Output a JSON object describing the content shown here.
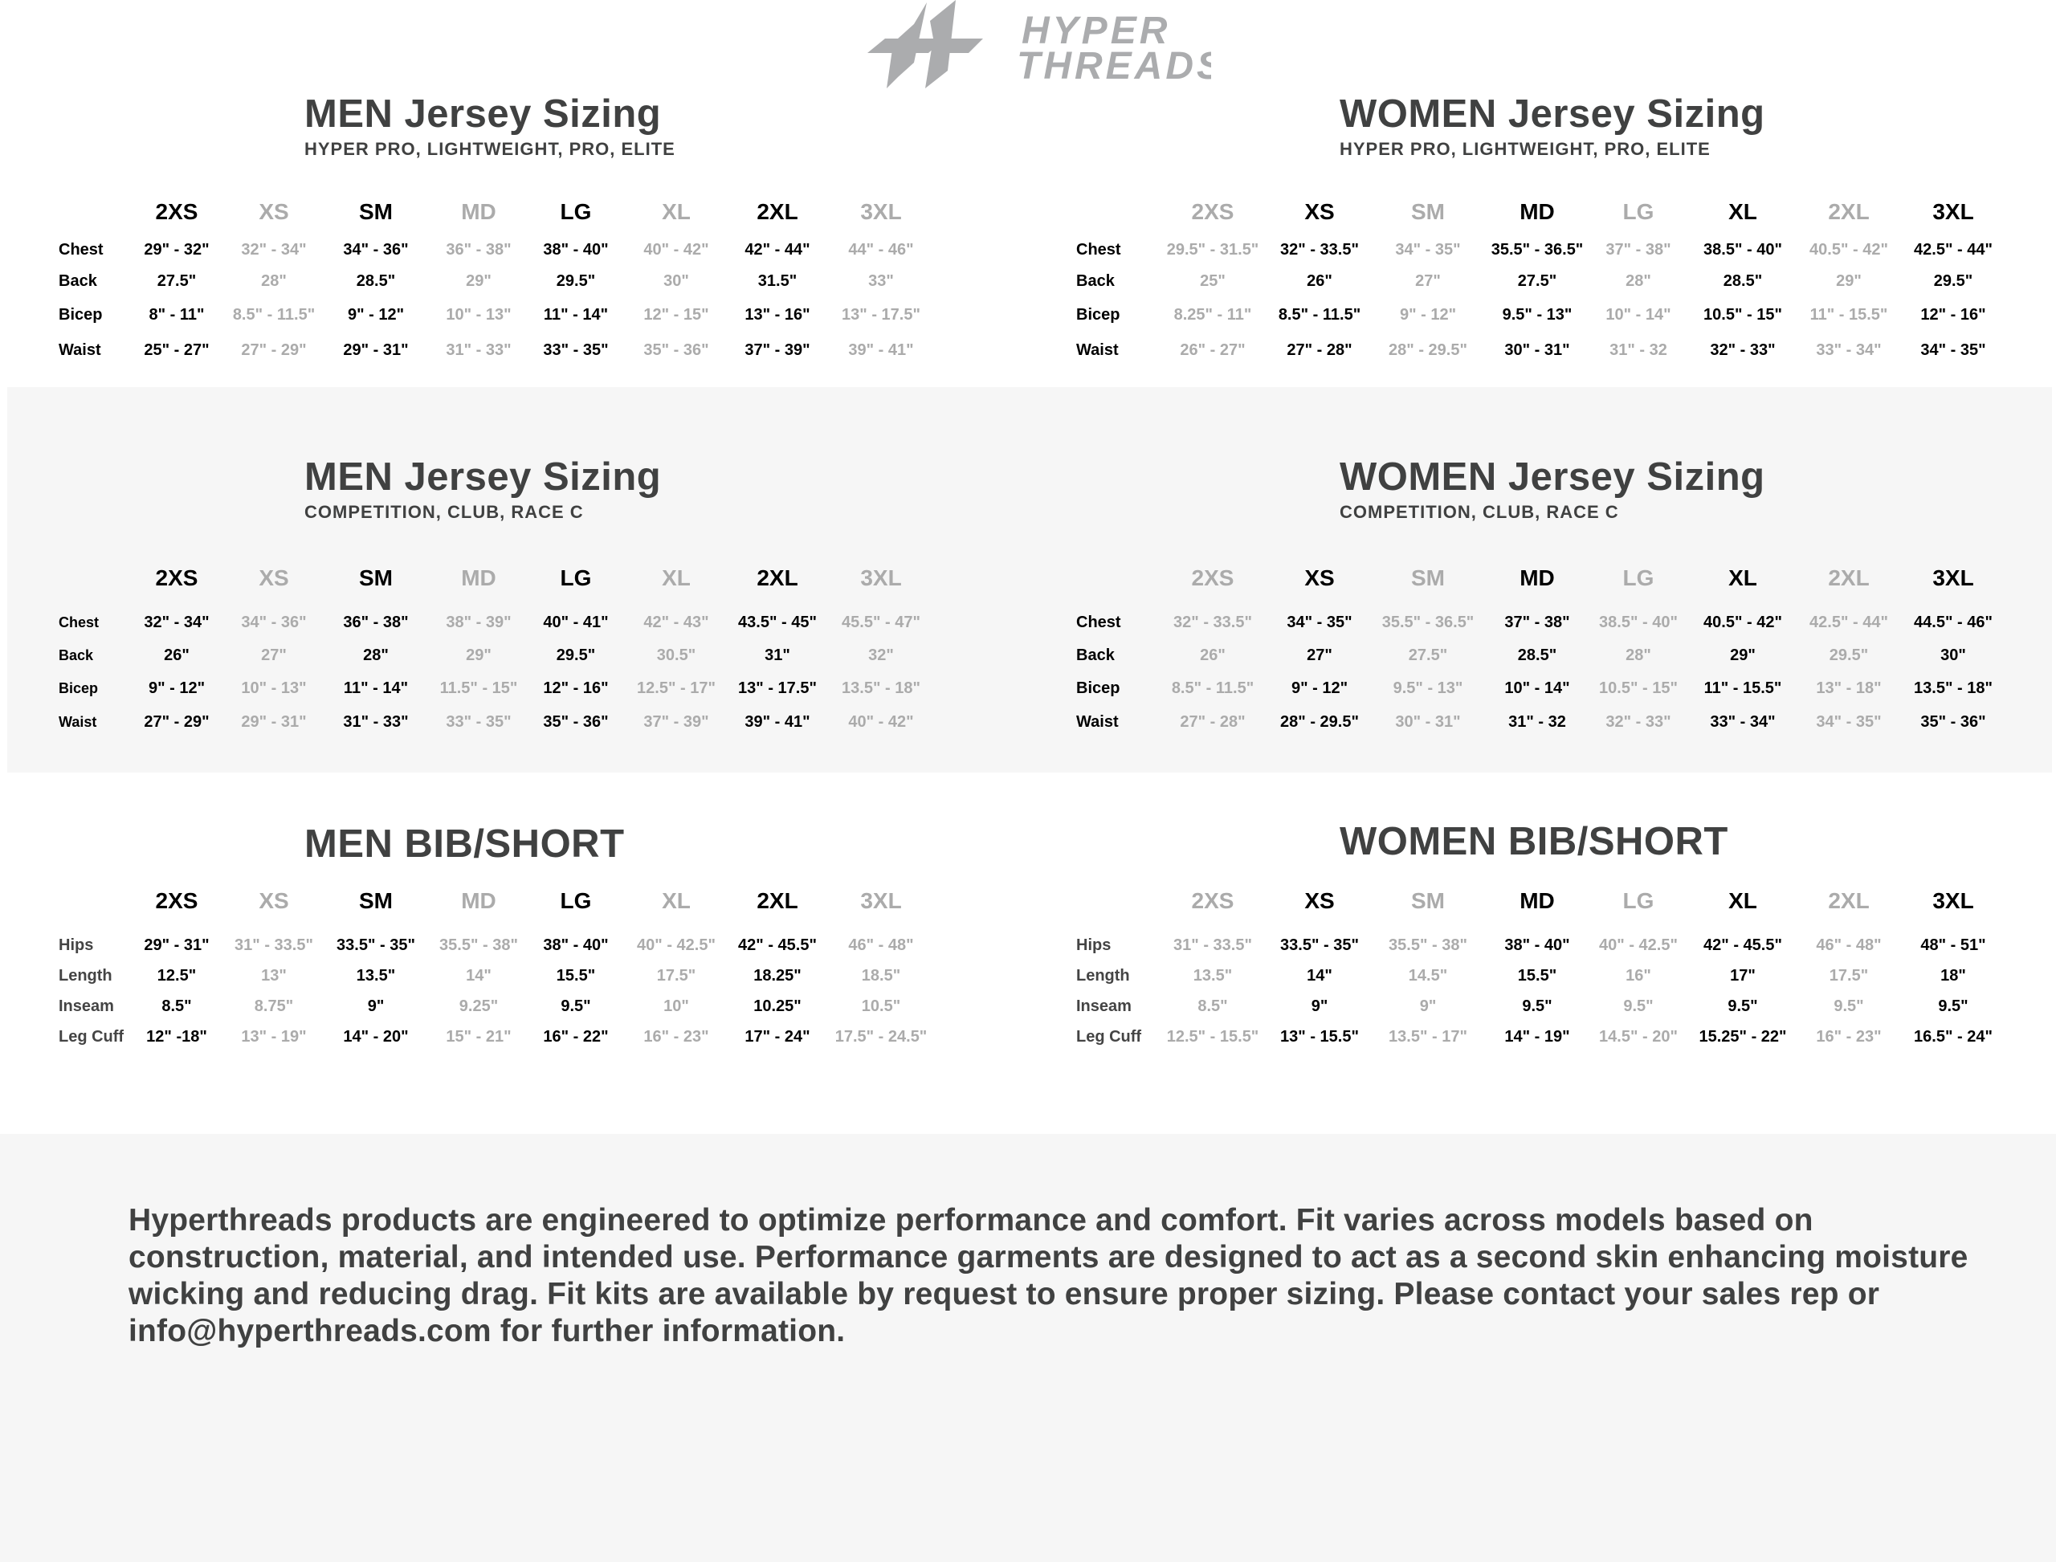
{
  "brand": {
    "name_line1": "HYPER",
    "name_line2": "THREADS",
    "logo_color": "#abacae"
  },
  "colors": {
    "heading": "#404141",
    "highlight_size": "#000000",
    "muted_size": "#ababab",
    "band_background": "#f6f6f6"
  },
  "sections": [
    {
      "id": "men-jersey-pro",
      "title": "MEN Jersey Sizing",
      "subtitle": "HYPER PRO, LIGHTWEIGHT, PRO, ELITE",
      "sizes": [
        "2XS",
        "XS",
        "SM",
        "MD",
        "LG",
        "XL",
        "2XL",
        "3XL"
      ],
      "highlight": [
        true,
        false,
        true,
        false,
        true,
        false,
        true,
        false
      ],
      "rows": [
        {
          "label": "Chest",
          "values": [
            "29\" - 32\"",
            "32\" - 34\"",
            "34\" - 36\"",
            "36\" - 38\"",
            "38\" - 40\"",
            "40\" - 42\"",
            "42\" - 44\"",
            "44\" - 46\""
          ]
        },
        {
          "label": "Back",
          "values": [
            "27.5\"",
            "28\"",
            "28.5\"",
            "29\"",
            "29.5\"",
            "30\"",
            "31.5\"",
            "33\""
          ]
        },
        {
          "label": "Bicep",
          "values": [
            "8\" - 11\"",
            "8.5\" - 11.5\"",
            "9\" - 12\"",
            "10\" - 13\"",
            "11\" - 14\"",
            "12\" - 15\"",
            "13\" - 16\"",
            "13\" - 17.5\""
          ]
        },
        {
          "label": "Waist",
          "values": [
            "25\" - 27\"",
            "27\" - 29\"",
            "29\" - 31\"",
            "31\" - 33\"",
            "33\" - 35\"",
            "35\" - 36\"",
            "37\" - 39\"",
            "39\" - 41\""
          ]
        }
      ]
    },
    {
      "id": "women-jersey-pro",
      "title": "WOMEN Jersey Sizing",
      "subtitle": "HYPER PRO, LIGHTWEIGHT, PRO, ELITE",
      "sizes": [
        "2XS",
        "XS",
        "SM",
        "MD",
        "LG",
        "XL",
        "2XL",
        "3XL"
      ],
      "highlight": [
        false,
        true,
        false,
        true,
        false,
        true,
        false,
        true
      ],
      "rows": [
        {
          "label": "Chest",
          "values": [
            "29.5\" - 31.5\"",
            "32\" - 33.5\"",
            "34\" - 35\"",
            "35.5\" - 36.5\"",
            "37\" - 38\"",
            "38.5\" - 40\"",
            "40.5\" - 42\"",
            "42.5\" - 44\""
          ]
        },
        {
          "label": "Back",
          "values": [
            "25\"",
            "26\"",
            "27\"",
            "27.5\"",
            "28\"",
            "28.5\"",
            "29\"",
            "29.5\""
          ]
        },
        {
          "label": "Bicep",
          "values": [
            "8.25\" - 11\"",
            "8.5\" - 11.5\"",
            "9\" - 12\"",
            "9.5\" - 13\"",
            "10\" - 14\"",
            "10.5\" - 15\"",
            "11\" - 15.5\"",
            "12\" - 16\""
          ]
        },
        {
          "label": "Waist",
          "values": [
            "26\" - 27\"",
            "27\" - 28\"",
            "28\" - 29.5\"",
            "30\" - 31\"",
            "31\" - 32",
            "32\" - 33\"",
            "33\" - 34\"",
            "34\" - 35\""
          ]
        }
      ]
    },
    {
      "id": "men-jersey-competition",
      "title": "MEN Jersey Sizing",
      "subtitle": "COMPETITION, CLUB, RACE C",
      "sizes": [
        "2XS",
        "XS",
        "SM",
        "MD",
        "LG",
        "XL",
        "2XL",
        "3XL"
      ],
      "highlight": [
        true,
        false,
        true,
        false,
        true,
        false,
        true,
        false
      ],
      "rows": [
        {
          "label": "Chest",
          "values": [
            "32\" - 34\"",
            "34\" - 36\"",
            "36\" - 38\"",
            "38\" - 39\"",
            "40\" - 41\"",
            "42\" - 43\"",
            "43.5\" - 45\"",
            "45.5\" - 47\""
          ]
        },
        {
          "label": "Back",
          "values": [
            "26\"",
            "27\"",
            "28\"",
            "29\"",
            "29.5\"",
            "30.5\"",
            "31\"",
            "32\""
          ]
        },
        {
          "label": "Bicep",
          "values": [
            "9\" - 12\"",
            "10\" - 13\"",
            "11\" - 14\"",
            "11.5\" - 15\"",
            "12\" - 16\"",
            "12.5\" - 17\"",
            "13\" - 17.5\"",
            "13.5\" - 18\""
          ]
        },
        {
          "label": "Waist",
          "values": [
            "27\" - 29\"",
            "29\" - 31\"",
            "31\" - 33\"",
            "33\" - 35\"",
            "35\" - 36\"",
            "37\" - 39\"",
            "39\" - 41\"",
            "40\" - 42\""
          ]
        }
      ]
    },
    {
      "id": "women-jersey-competition",
      "title": "WOMEN Jersey Sizing",
      "subtitle": "COMPETITION, CLUB, RACE C",
      "sizes": [
        "2XS",
        "XS",
        "SM",
        "MD",
        "LG",
        "XL",
        "2XL",
        "3XL"
      ],
      "highlight": [
        false,
        true,
        false,
        true,
        false,
        true,
        false,
        true
      ],
      "rows": [
        {
          "label": "Chest",
          "values": [
            "32\" - 33.5\"",
            "34\" - 35\"",
            "35.5\" - 36.5\"",
            "37\" - 38\"",
            "38.5\" - 40\"",
            "40.5\" - 42\"",
            "42.5\" - 44\"",
            "44.5\" - 46\""
          ]
        },
        {
          "label": "Back",
          "values": [
            "26\"",
            "27\"",
            "27.5\"",
            "28.5\"",
            "28\"",
            "29\"",
            "29.5\"",
            "30\""
          ]
        },
        {
          "label": "Bicep",
          "values": [
            "8.5\" - 11.5\"",
            "9\" - 12\"",
            "9.5\" - 13\"",
            "10\" - 14\"",
            "10.5\" - 15\"",
            "11\" - 15.5\"",
            "13\" - 18\"",
            "13.5\" - 18\""
          ]
        },
        {
          "label": "Waist",
          "values": [
            "27\" - 28\"",
            "28\" - 29.5\"",
            "30\" - 31\"",
            "31\" - 32",
            "32\" - 33\"",
            "33\" - 34\"",
            "34\" - 35\"",
            "35\" - 36\""
          ]
        }
      ]
    },
    {
      "id": "men-bib-short",
      "title": "MEN BIB/SHORT",
      "subtitle": "",
      "sizes": [
        "2XS",
        "XS",
        "SM",
        "MD",
        "LG",
        "XL",
        "2XL",
        "3XL"
      ],
      "highlight": [
        true,
        false,
        true,
        false,
        true,
        false,
        true,
        false
      ],
      "rows": [
        {
          "label": "Hips",
          "values": [
            "29\" - 31\"",
            "31\" - 33.5\"",
            "33.5\" - 35\"",
            "35.5\" - 38\"",
            "38\" - 40\"",
            "40\" - 42.5\"",
            "42\" - 45.5\"",
            "46\" - 48\""
          ]
        },
        {
          "label": "Length",
          "values": [
            "12.5\"",
            "13\"",
            "13.5\"",
            "14\"",
            "15.5\"",
            "17.5\"",
            "18.25\"",
            "18.5\""
          ]
        },
        {
          "label": "Inseam",
          "values": [
            "8.5\"",
            "8.75\"",
            "9\"",
            "9.25\"",
            "9.5\"",
            "10\"",
            "10.25\"",
            "10.5\""
          ]
        },
        {
          "label": "Leg Cuff",
          "values": [
            "12\" -18\"",
            "13\" - 19\"",
            "14\" - 20\"",
            "15\" - 21\"",
            "16\" - 22\"",
            "16\" - 23\"",
            "17\" - 24\"",
            "17.5\" - 24.5\""
          ]
        }
      ]
    },
    {
      "id": "women-bib-short",
      "title": "WOMEN BIB/SHORT",
      "subtitle": "",
      "sizes": [
        "2XS",
        "XS",
        "SM",
        "MD",
        "LG",
        "XL",
        "2XL",
        "3XL"
      ],
      "highlight": [
        false,
        true,
        false,
        true,
        false,
        true,
        false,
        true
      ],
      "rows": [
        {
          "label": "Hips",
          "values": [
            "31\" - 33.5\"",
            "33.5\" - 35\"",
            "35.5\" - 38\"",
            "38\" - 40\"",
            "40\" - 42.5\"",
            "42\" - 45.5\"",
            "46\" - 48\"",
            "48\" - 51\""
          ]
        },
        {
          "label": "Length",
          "values": [
            "13.5\"",
            "14\"",
            "14.5\"",
            "15.5\"",
            "16\"",
            "17\"",
            "17.5\"",
            "18\""
          ]
        },
        {
          "label": "Inseam",
          "values": [
            "8.5\"",
            "9\"",
            "9\"",
            "9.5\"",
            "9.5\"",
            "9.5\"",
            "9.5\"",
            "9.5\""
          ]
        },
        {
          "label": "Leg Cuff",
          "values": [
            "12.5\" - 15.5\"",
            "13\" - 15.5\"",
            "13.5\" - 17\"",
            "14\" - 19\"",
            "14.5\" - 20\"",
            "15.25\" - 22\"",
            "16\" - 23\"",
            "16.5\" - 24\""
          ]
        }
      ]
    }
  ],
  "footer": {
    "text": "Hyperthreads products are engineered to optimize performance and comfort. Fit varies across models based on construction, material, and intended use. Performance garments are designed to act as a second skin enhancing moisture wicking and reducing drag. Fit kits are available by request to ensure proper sizing. Please contact your sales rep or info@hyperthreads.com for further information."
  }
}
